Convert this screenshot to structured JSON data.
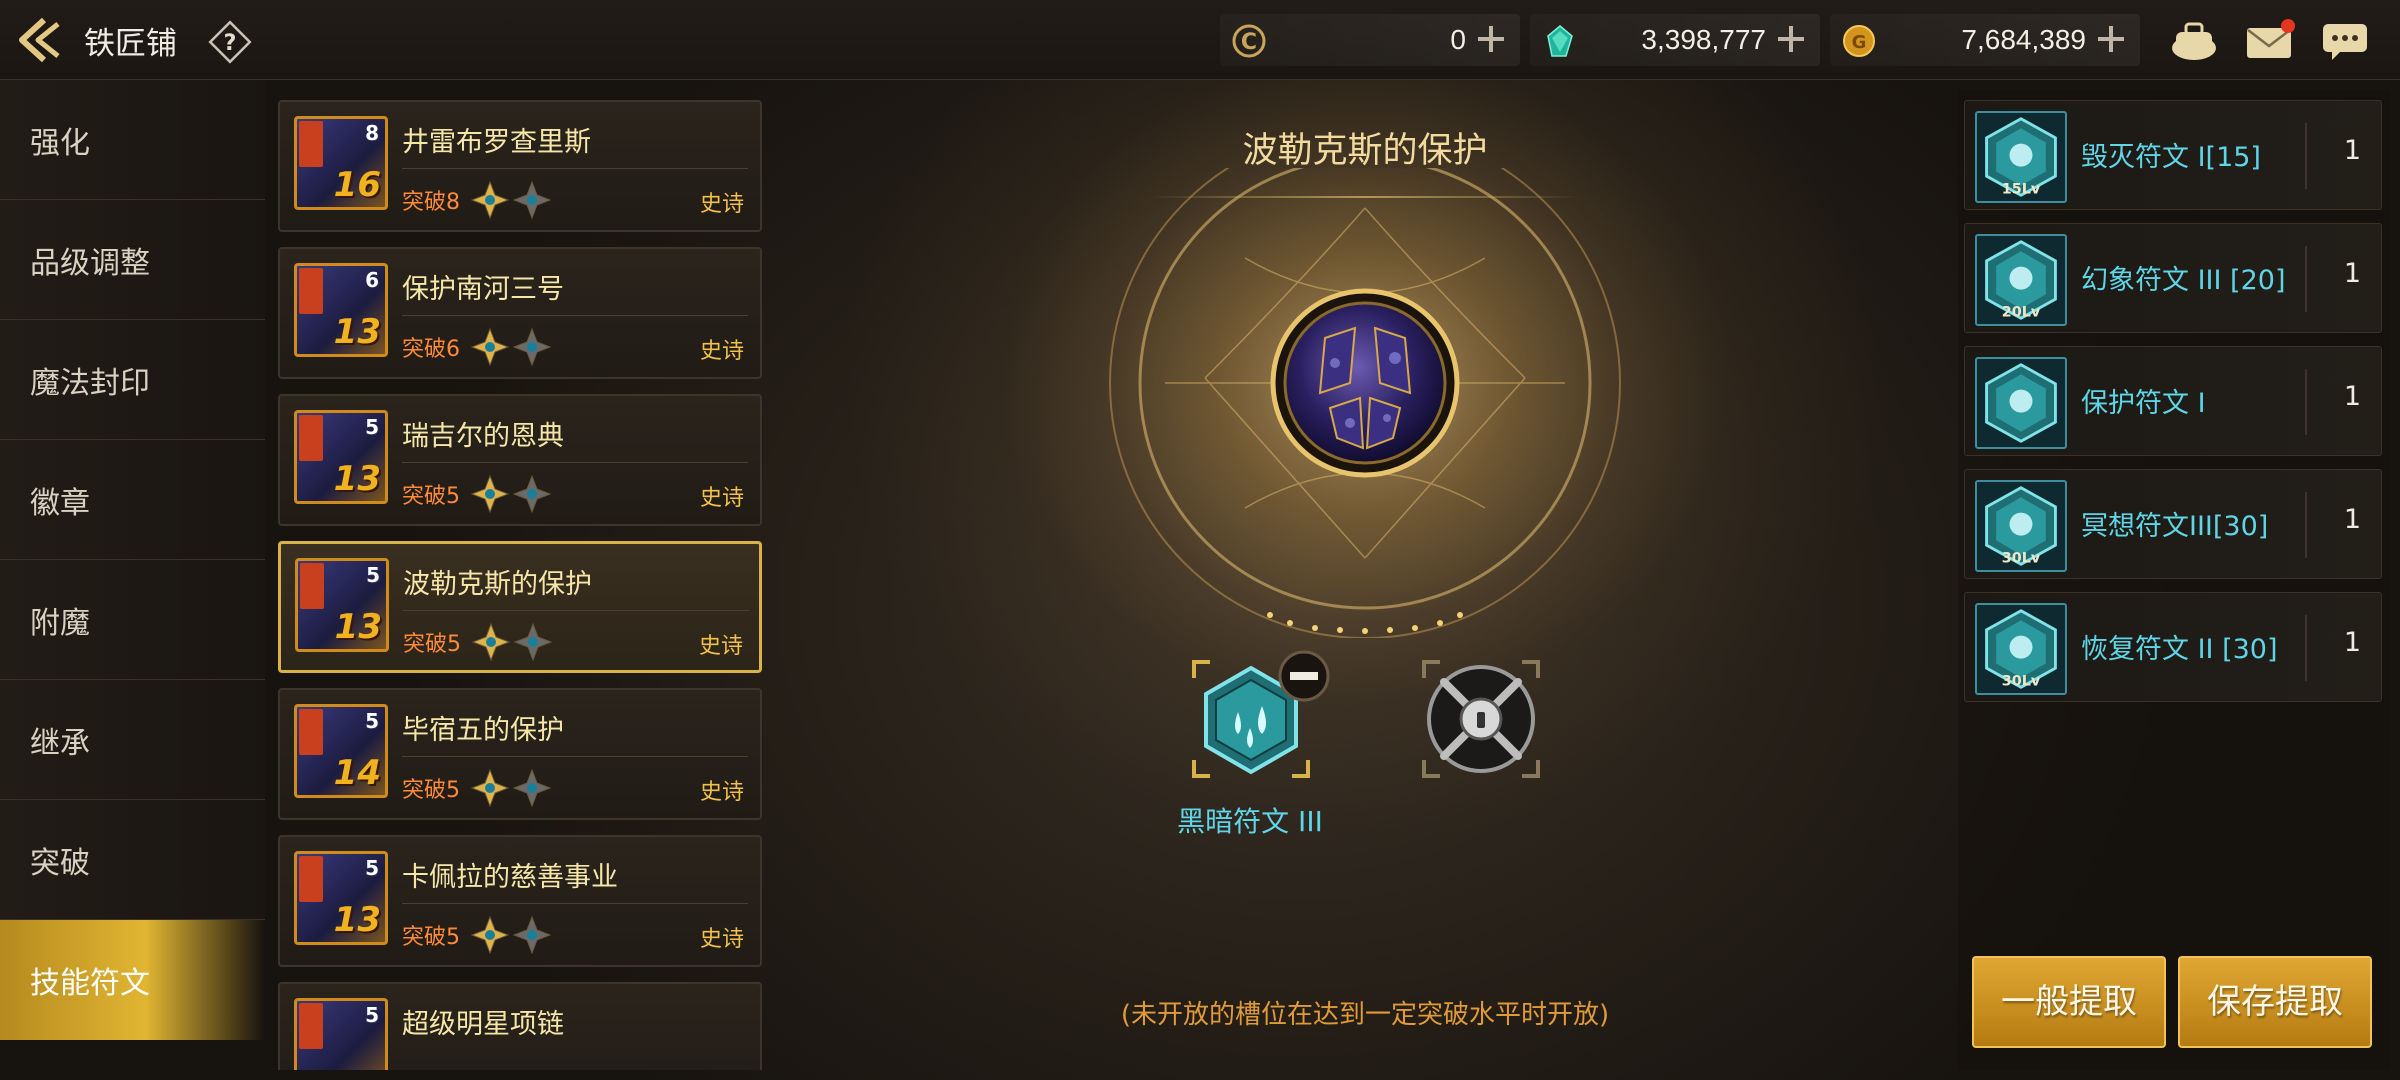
{
  "header": {
    "title": "铁匠铺",
    "currencies": [
      {
        "icon": "c-coin-icon",
        "value": "0"
      },
      {
        "icon": "green-gem-icon",
        "value": "3,398,777"
      },
      {
        "icon": "gold-coin-icon",
        "value": "7,684,389"
      }
    ]
  },
  "menu": {
    "items": [
      {
        "label": "强化"
      },
      {
        "label": "品级调整"
      },
      {
        "label": "魔法封印"
      },
      {
        "label": "徽章"
      },
      {
        "label": "附魔"
      },
      {
        "label": "继承"
      },
      {
        "label": "突破"
      },
      {
        "label": "技能符文"
      }
    ],
    "active_index": 7
  },
  "items": [
    {
      "name": "井雷布罗查里斯",
      "break": "突破8",
      "rank": "史诗",
      "level": "16",
      "star": "8"
    },
    {
      "name": "保护南河三号",
      "break": "突破6",
      "rank": "史诗",
      "level": "13",
      "star": "6"
    },
    {
      "name": "瑞吉尔的恩典",
      "break": "突破5",
      "rank": "史诗",
      "level": "13",
      "star": "5"
    },
    {
      "name": "波勒克斯的保护",
      "break": "突破5",
      "rank": "史诗",
      "level": "13",
      "star": "5"
    },
    {
      "name": "毕宿五的保护",
      "break": "突破5",
      "rank": "史诗",
      "level": "14",
      "star": "5"
    },
    {
      "name": "卡佩拉的慈善事业",
      "break": "突破5",
      "rank": "史诗",
      "level": "13",
      "star": "5"
    },
    {
      "name": "超级明星项链",
      "break": "",
      "rank": "",
      "level": "",
      "star": "5"
    }
  ],
  "selected_item_index": 3,
  "center": {
    "title": "波勒克斯的保护",
    "slot1_label": "黑暗符文 III",
    "notice": "(未开放的槽位在达到一定突破水平时开放)"
  },
  "runes": [
    {
      "name": "毁灭符文 I[15]",
      "count": "1",
      "lv": "15Lv"
    },
    {
      "name": "幻象符文 III [20]",
      "count": "1",
      "lv": "20Lv"
    },
    {
      "name": "保护符文 I",
      "count": "1",
      "lv": ""
    },
    {
      "name": "冥想符文III[30]",
      "count": "1",
      "lv": "30Lv"
    },
    {
      "name": "恢复符文 II [30]",
      "count": "1",
      "lv": "30Lv"
    }
  ],
  "buttons": {
    "normal_extract": "一般提取",
    "save_extract": "保存提取"
  },
  "colors": {
    "accent_gold": "#e1b532",
    "rune_cyan": "#5fd6e8",
    "break_orange": "#ff8a3a"
  }
}
